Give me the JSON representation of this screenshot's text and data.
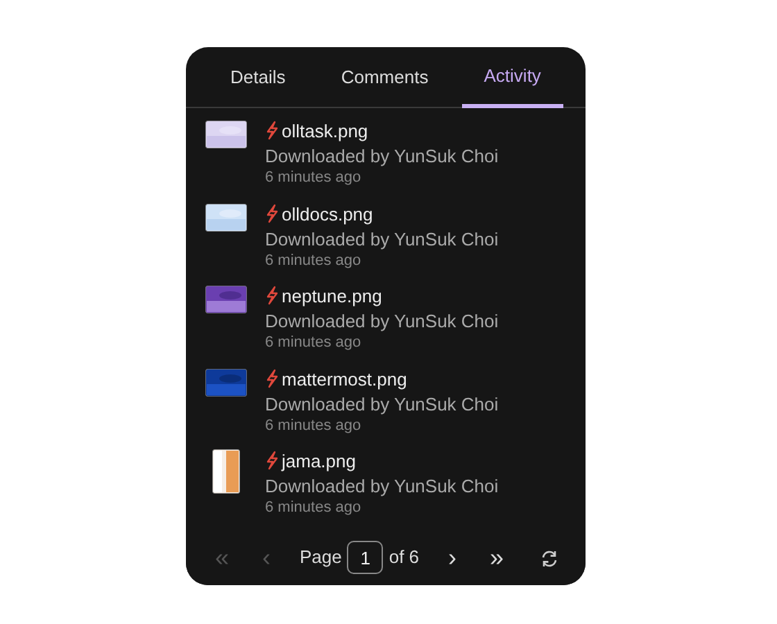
{
  "tabs": [
    {
      "label": "Details",
      "selected": false
    },
    {
      "label": "Comments",
      "selected": false
    },
    {
      "label": "Activity",
      "selected": true
    }
  ],
  "activity": [
    {
      "file": "olltask.png",
      "action": "Downloaded by YunSuk Choi",
      "time": "6 minutes ago"
    },
    {
      "file": "olldocs.png",
      "action": "Downloaded by YunSuk Choi",
      "time": "6 minutes ago"
    },
    {
      "file": "neptune.png",
      "action": "Downloaded by YunSuk Choi",
      "time": "6 minutes ago"
    },
    {
      "file": "mattermost.png",
      "action": "Downloaded by YunSuk Choi",
      "time": "6 minutes ago"
    },
    {
      "file": "jama.png",
      "action": "Downloaded by YunSuk Choi",
      "time": "6 minutes ago"
    }
  ],
  "pagination": {
    "first": {
      "glyph": "«",
      "disabled": true
    },
    "prev": {
      "glyph": "‹",
      "disabled": true
    },
    "label": "Page",
    "page": "1",
    "of": "of 6",
    "next": {
      "glyph": "›",
      "disabled": false
    },
    "last": {
      "glyph": "»",
      "disabled": false
    }
  }
}
